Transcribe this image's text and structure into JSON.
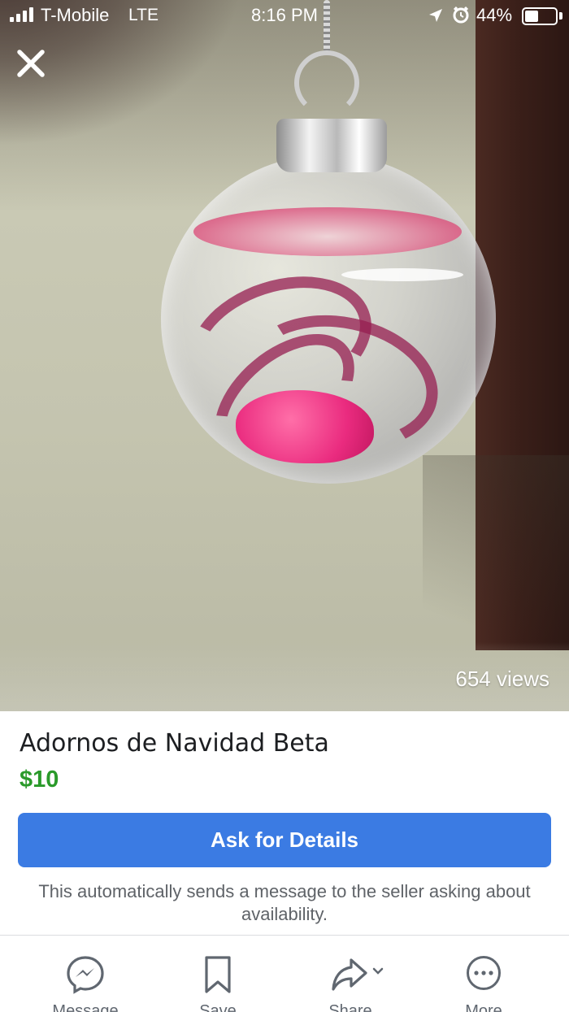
{
  "status_bar": {
    "carrier": "T-Mobile",
    "network": "LTE",
    "time": "8:16 PM",
    "battery": "44%",
    "battery_level": 0.44,
    "icons": [
      "signal-icon",
      "location-arrow-icon",
      "alarm-clock-icon",
      "battery-icon"
    ]
  },
  "photo": {
    "views": "654 views"
  },
  "listing": {
    "title": "Adornos de Navidad Beta",
    "price": "$10",
    "price_color": "#2a9a2a"
  },
  "cta": {
    "label": "Ask for Details",
    "color": "#3b7be3",
    "helper": "This automatically sends a message to the seller asking about availability."
  },
  "actions": [
    {
      "label": "Message",
      "icon": "messenger-icon"
    },
    {
      "label": "Save",
      "icon": "bookmark-icon"
    },
    {
      "label": "Share",
      "icon": "share-arrow-icon"
    },
    {
      "label": "More",
      "icon": "more-dots-icon"
    }
  ]
}
